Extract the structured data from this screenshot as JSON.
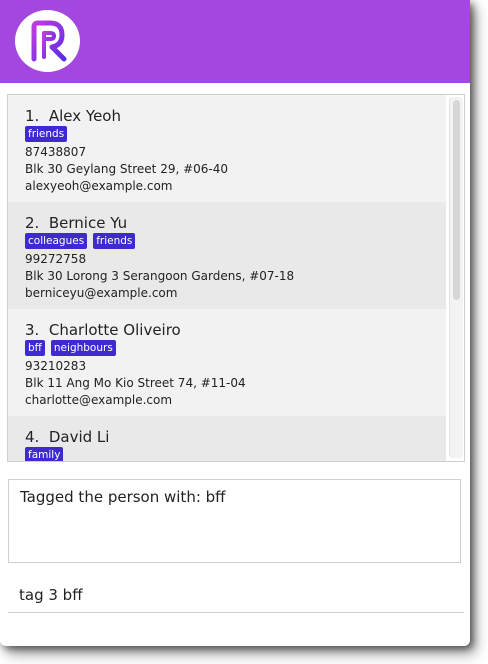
{
  "app": {
    "logo_icon": "app-logo-r-icon",
    "header_color": "#a347de",
    "tag_color": "#3e2ad0"
  },
  "persons": [
    {
      "index": "1.",
      "name": "Alex Yeoh",
      "tags": [
        "friends"
      ],
      "phone": "87438807",
      "address": "Blk 30 Geylang Street 29, #06-40",
      "email": "alexyeoh@example.com"
    },
    {
      "index": "2.",
      "name": "Bernice Yu",
      "tags": [
        "colleagues",
        "friends"
      ],
      "phone": "99272758",
      "address": "Blk 30 Lorong 3 Serangoon Gardens, #07-18",
      "email": "berniceyu@example.com"
    },
    {
      "index": "3.",
      "name": "Charlotte Oliveiro",
      "tags": [
        "bff",
        "neighbours"
      ],
      "phone": "93210283",
      "address": "Blk 11 Ang Mo Kio Street 74, #11-04",
      "email": "charlotte@example.com"
    },
    {
      "index": "4.",
      "name": "David Li",
      "tags": [
        "family"
      ]
    }
  ],
  "result_display": {
    "text": "Tagged the person with: bff"
  },
  "command_box": {
    "value": "tag 3 bff"
  }
}
